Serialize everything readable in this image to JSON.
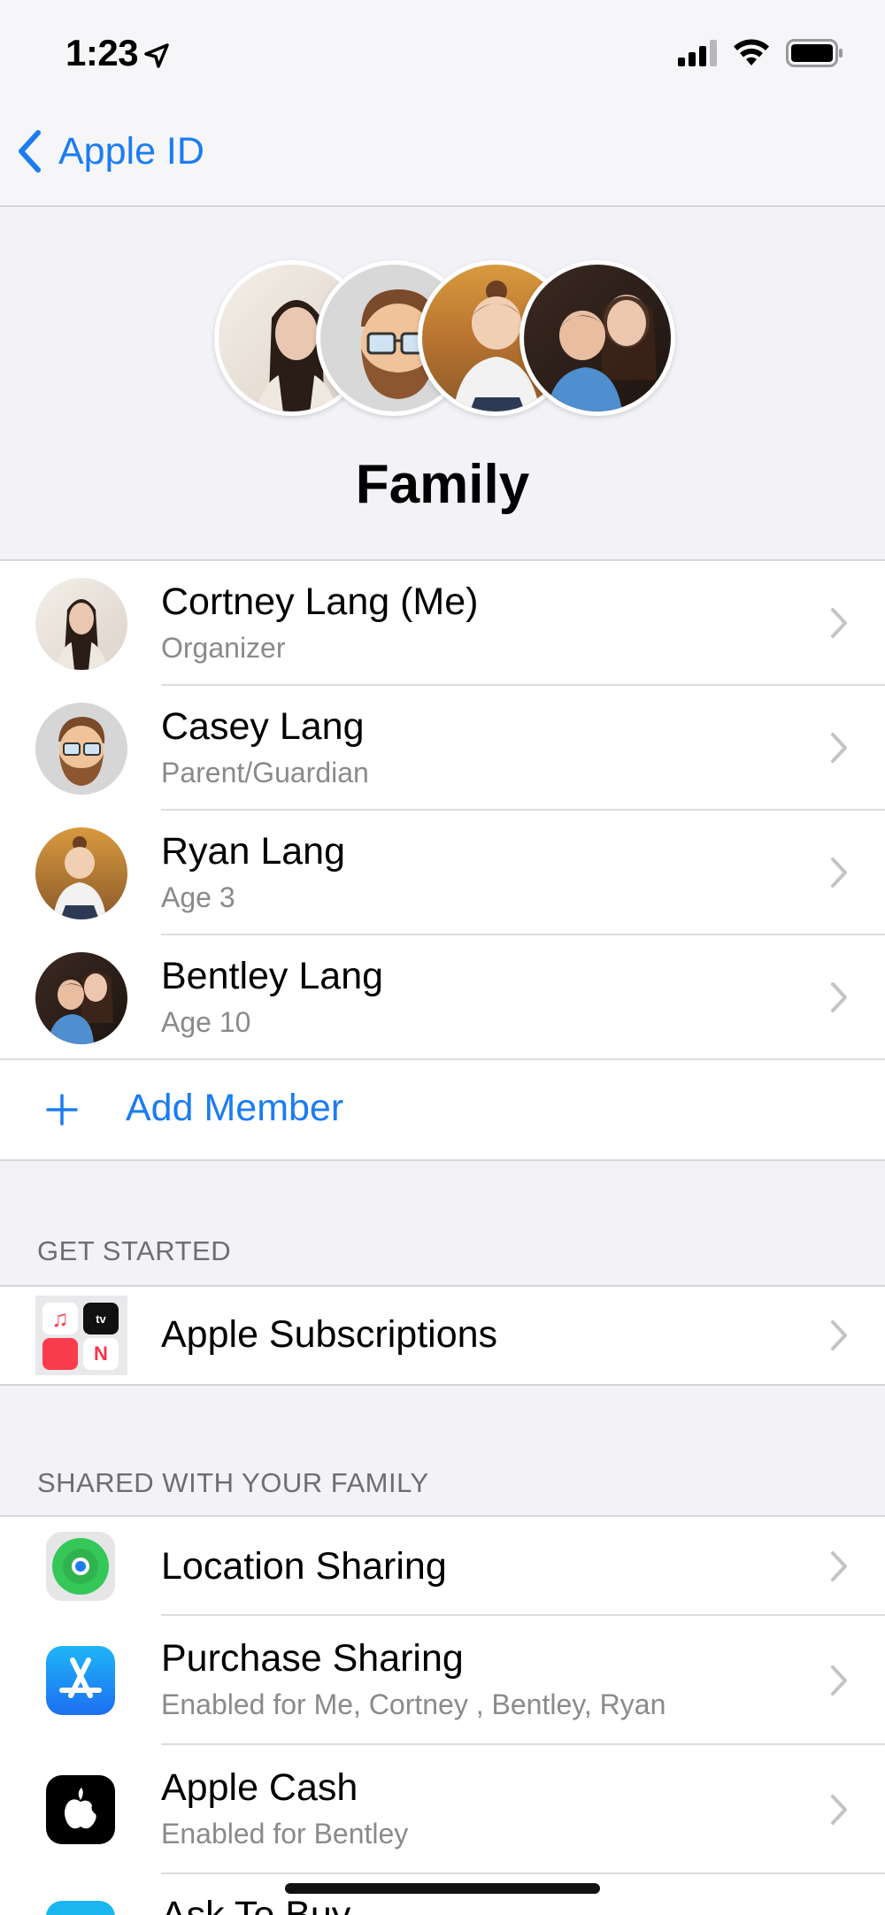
{
  "status": {
    "time": "1:23"
  },
  "nav": {
    "back_label": "Apple ID"
  },
  "header": {
    "title": "Family"
  },
  "members": [
    {
      "name": "Cortney  Lang (Me)",
      "role": "Organizer",
      "avatar": "woman-photo"
    },
    {
      "name": "Casey Lang",
      "role": "Parent/Guardian",
      "avatar": "memoji-bearded-man"
    },
    {
      "name": "Ryan Lang",
      "role": "Age 3",
      "avatar": "toddler-photo"
    },
    {
      "name": "Bentley Lang",
      "role": "Age 10",
      "avatar": "boy-photo"
    }
  ],
  "add_member_label": "Add Member",
  "get_started": {
    "header": "GET STARTED",
    "items": [
      {
        "title": "Apple Subscriptions",
        "icon": "apple-subscriptions-icon"
      }
    ]
  },
  "shared": {
    "header": "SHARED WITH YOUR FAMILY",
    "items": [
      {
        "title": "Location Sharing",
        "subtitle": "",
        "icon": "find-my-icon"
      },
      {
        "title": "Purchase Sharing",
        "subtitle": "Enabled for Me, Cortney , Bentley, Ryan",
        "icon": "app-store-icon"
      },
      {
        "title": "Apple Cash",
        "subtitle": "Enabled for Bentley",
        "icon": "apple-cash-icon"
      },
      {
        "title": "Ask To Buy",
        "subtitle": "",
        "icon": "ask-to-buy-icon"
      }
    ]
  },
  "colors": {
    "accent": "#1b7cf2",
    "background": "#f2f2f7",
    "separator": "#dcdce0"
  }
}
